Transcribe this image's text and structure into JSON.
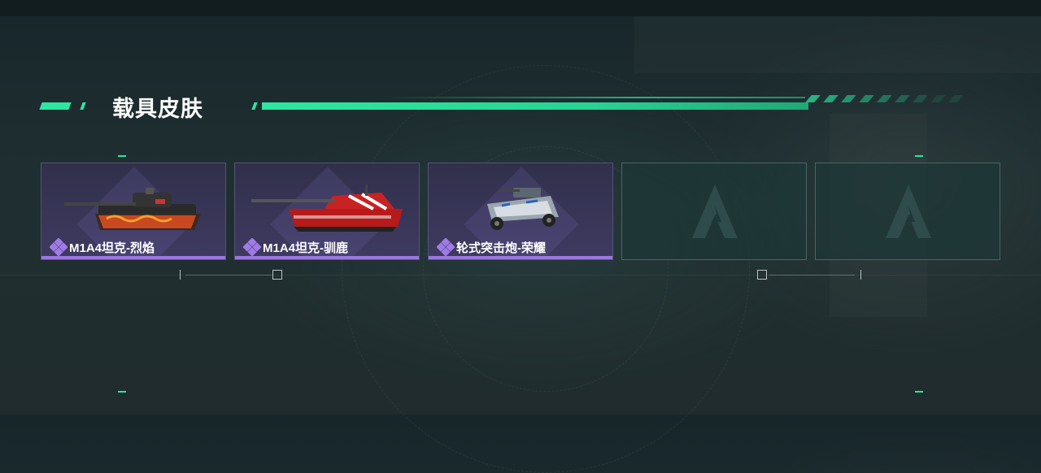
{
  "section": {
    "title": "载具皮肤"
  },
  "skins": [
    {
      "name": "M1A4坦克-烈焰",
      "rarity_icon": "purple-diamond-icon",
      "vehicle_icon": "tank-icon",
      "owned": true
    },
    {
      "name": "M1A4坦克-驯鹿",
      "rarity_icon": "purple-diamond-icon",
      "vehicle_icon": "tank-icon",
      "owned": true
    },
    {
      "name": "轮式突击炮-荣耀",
      "rarity_icon": "purple-diamond-icon",
      "vehicle_icon": "armored-car-icon",
      "owned": true
    },
    {
      "name": "",
      "placeholder_icon": "game-logo-icon",
      "owned": false
    },
    {
      "name": "",
      "placeholder_icon": "game-logo-icon",
      "owned": false
    }
  ],
  "colors": {
    "accent_green": "#2ee6a1",
    "rarity_purple": "#9b77e0",
    "card_purple": "#3e3a61",
    "empty_card": "#1e3737"
  }
}
